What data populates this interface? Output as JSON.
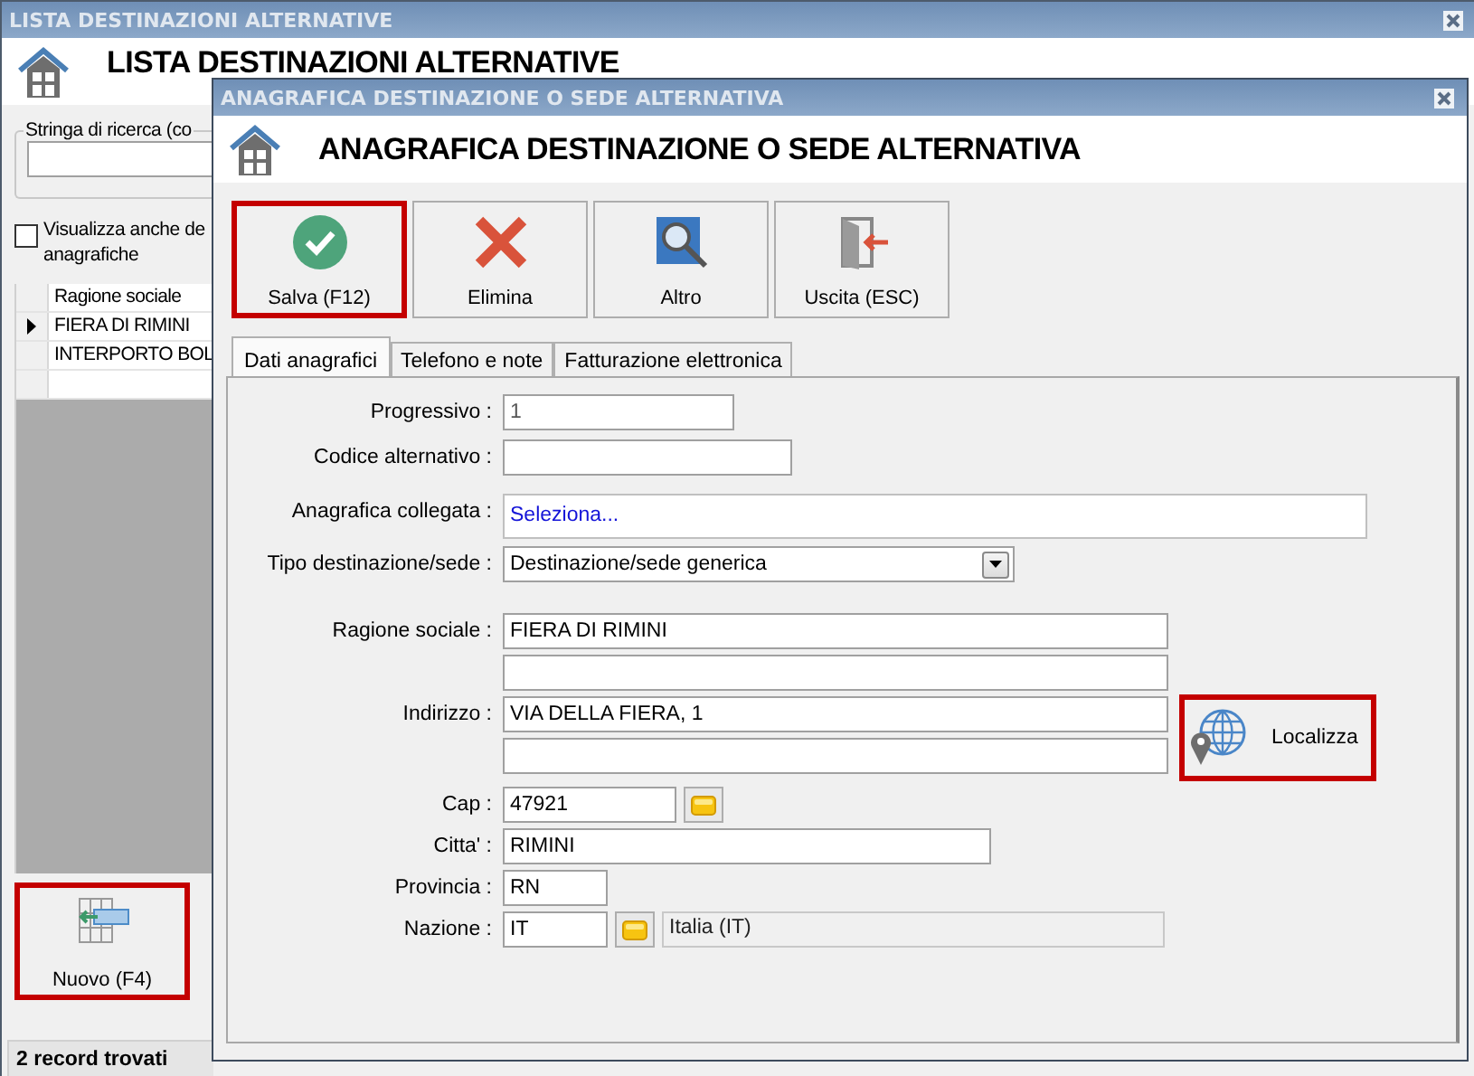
{
  "lista_window": {
    "title": "LISTA DESTINAZIONI ALTERNATIVE",
    "heading": "LISTA DESTINAZIONI ALTERNATIVE",
    "search": {
      "label": "Stringa di ricerca (co"
    },
    "include_checkbox": {
      "label": "Visualizza anche de\nanagrafiche",
      "checked": false
    },
    "table": {
      "columns": [
        "Ragione sociale"
      ],
      "rows": [
        {
          "cells": [
            "FIERA DI RIMINI"
          ],
          "selected": true
        },
        {
          "cells": [
            "INTERPORTO BOL"
          ],
          "selected": false
        }
      ]
    },
    "buttons": [
      {
        "label": "Nuovo (F4)",
        "kind": "new",
        "highlighted": true
      }
    ],
    "status_bar": "2 record trovati"
  },
  "dialog": {
    "title": "ANAGRAFICA DESTINAZIONE O SEDE ALTERNATIVA",
    "heading": "ANAGRAFICA DESTINAZIONE O SEDE ALTERNATIVA",
    "toolbar": [
      {
        "label": "Salva (F12)",
        "kind": "save",
        "highlighted": true
      },
      {
        "label": "Elimina",
        "kind": "delete",
        "highlighted": false
      },
      {
        "label": "Altro",
        "kind": "search",
        "highlighted": false
      },
      {
        "label": "Uscita (ESC)",
        "kind": "exit",
        "highlighted": false
      }
    ],
    "tabs": [
      {
        "label": "Dati anagrafici",
        "selected": true
      },
      {
        "label": "Telefono e note",
        "selected": false
      },
      {
        "label": "Fatturazione elettronica",
        "selected": false
      }
    ],
    "form": {
      "sections": [
        {
          "rows": [
            {
              "label": "Progressivo :",
              "lines": [
                [
                  {
                    "kind": "readonly",
                    "value": "1"
                  }
                ]
              ]
            },
            {
              "label": "Codice alternativo :",
              "lines": [
                [
                  {
                    "kind": "text"
                  }
                ]
              ]
            }
          ]
        },
        {
          "rows": [
            {
              "label": "Anagrafica collegata :",
              "lines": [
                [
                  {
                    "kind": "link",
                    "value": "Seleziona..."
                  }
                ]
              ]
            },
            {
              "label": "Tipo destinazione/sede :",
              "lines": [
                [
                  {
                    "kind": "select",
                    "value": "Destinazione/sede generica"
                  }
                ]
              ]
            }
          ]
        },
        {
          "rows": [
            {
              "label": "Ragione sociale :",
              "lines": [
                [
                  {
                    "kind": "text",
                    "value": "FIERA DI RIMINI"
                  }
                ],
                [
                  {
                    "kind": "text"
                  }
                ]
              ]
            },
            {
              "label": "Indirizzo :",
              "lines": [
                [
                  {
                    "kind": "text",
                    "value": "VIA DELLA FIERA, 1"
                  }
                ],
                [
                  {
                    "kind": "text"
                  }
                ]
              ],
              "button": {
                "label": "Localizza",
                "kind": "locate",
                "highlighted": true
              }
            },
            {
              "label": "Cap :",
              "lines": [
                [
                  {
                    "kind": "text",
                    "value": "47921"
                  },
                  {
                    "kind": "browse"
                  }
                ]
              ]
            },
            {
              "label": "Citta' :",
              "lines": [
                [
                  {
                    "kind": "text",
                    "value": "RIMINI"
                  }
                ]
              ]
            },
            {
              "label": "Provincia :",
              "lines": [
                [
                  {
                    "kind": "text",
                    "value": "RN"
                  }
                ]
              ]
            },
            {
              "label": "Nazione :",
              "lines": [
                [
                  {
                    "kind": "text",
                    "value": "IT"
                  },
                  {
                    "kind": "browse"
                  },
                  {
                    "kind": "display",
                    "value": "Italia (IT)"
                  }
                ]
              ]
            }
          ]
        }
      ]
    }
  }
}
